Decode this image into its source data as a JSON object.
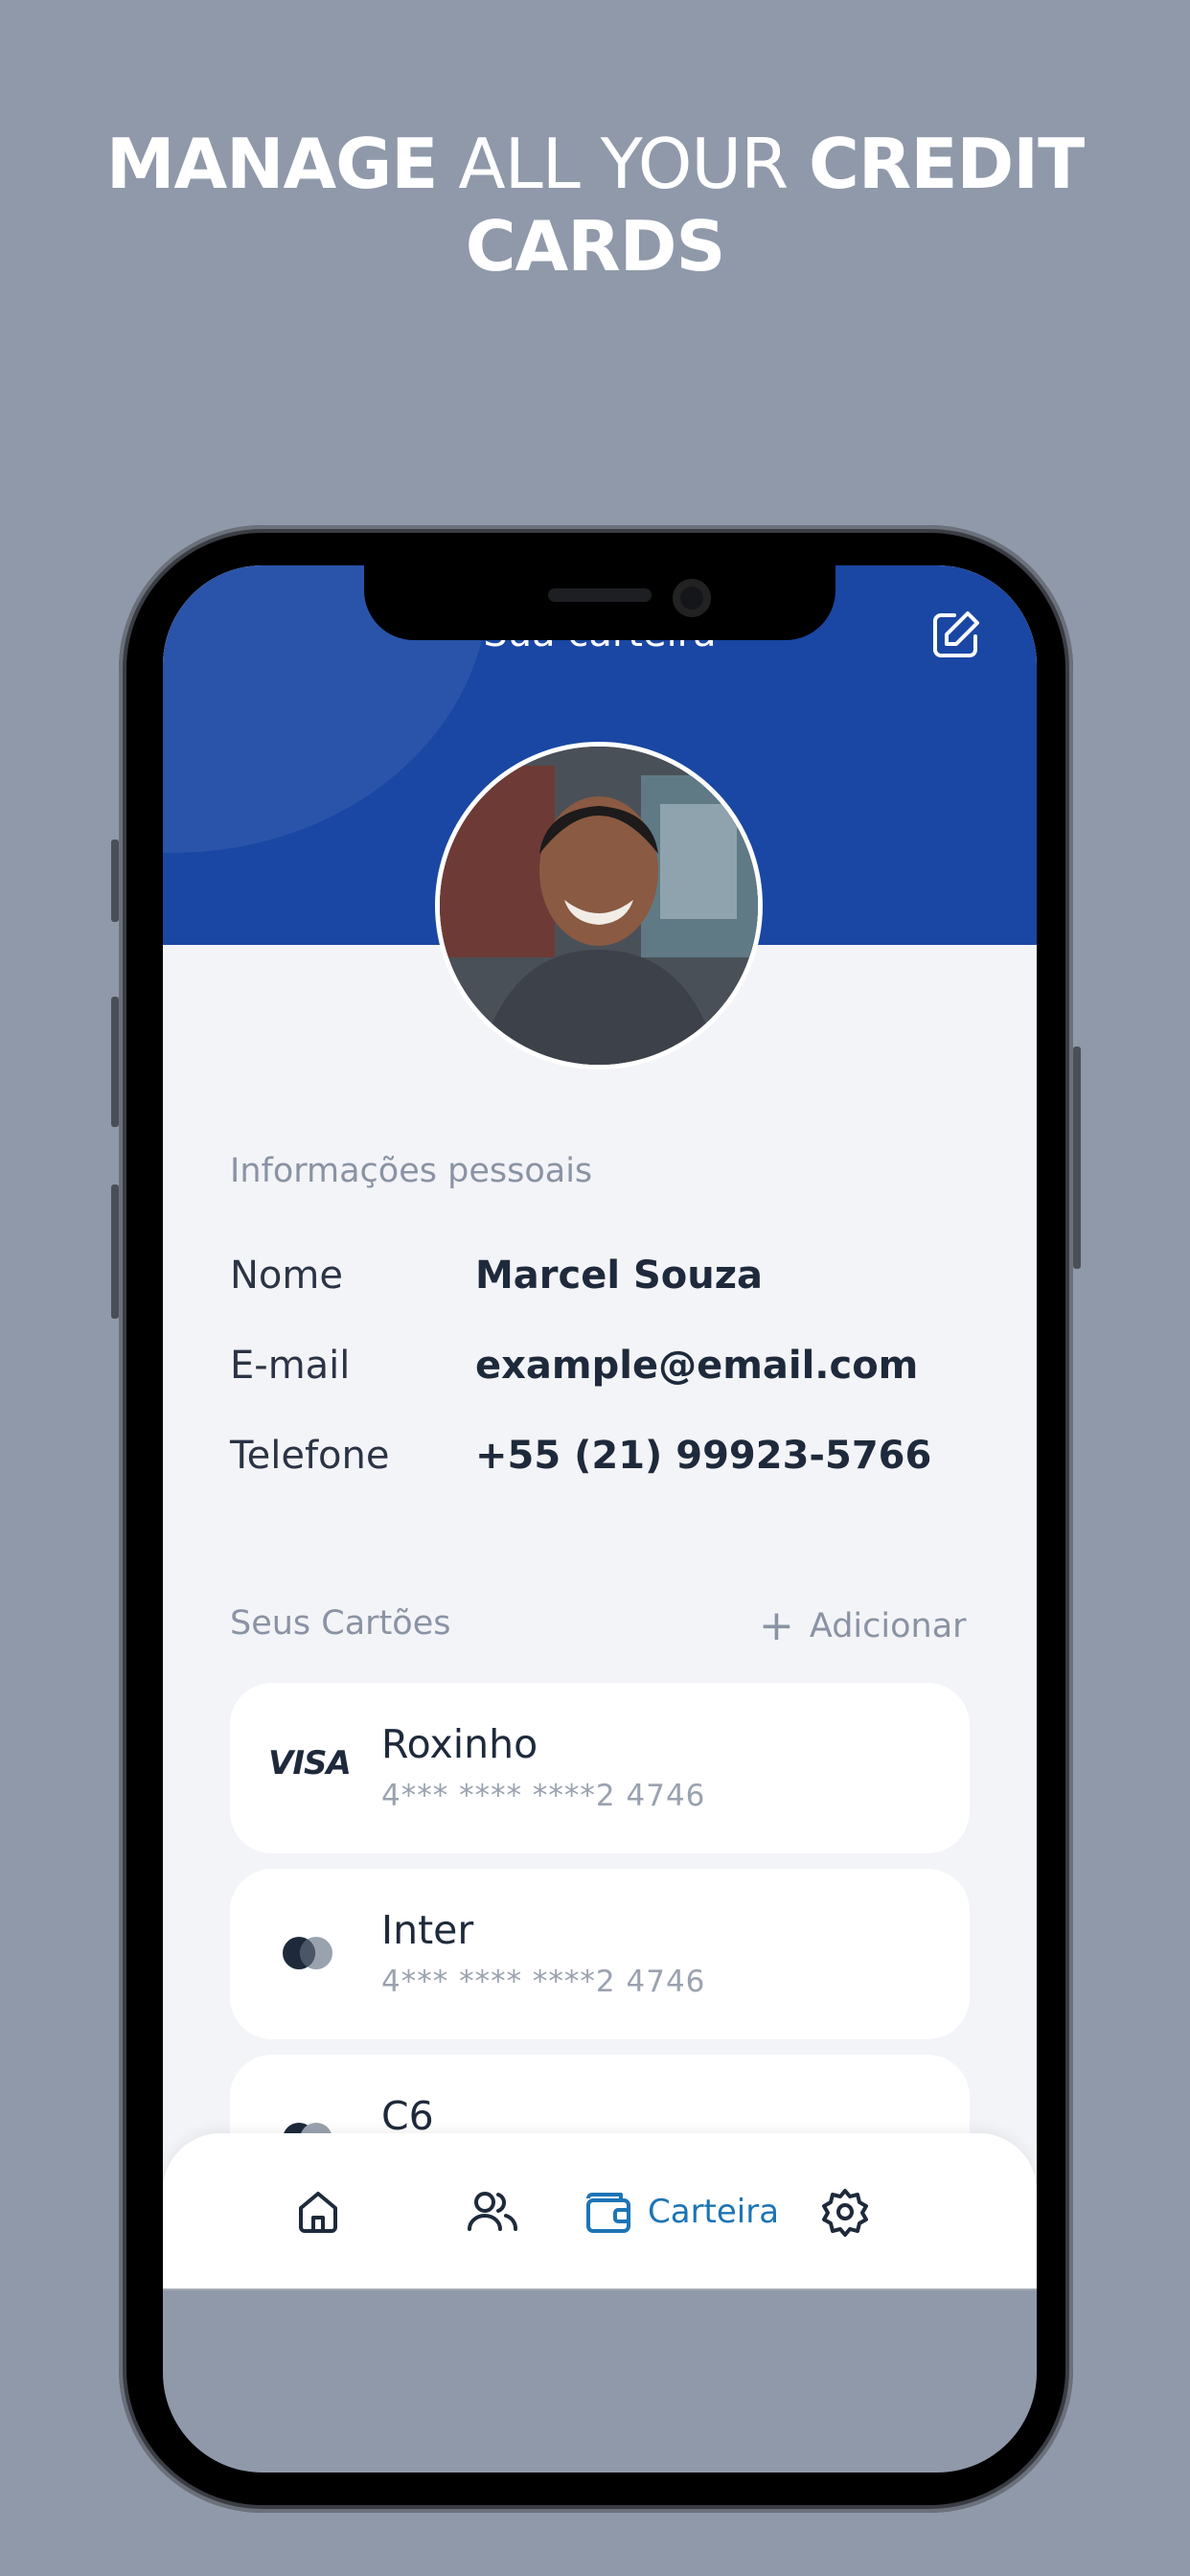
{
  "headline": {
    "bold_1": "MANAGE",
    "light": "ALL YOUR",
    "bold_2": "CREDIT",
    "line2": "CARDS"
  },
  "header": {
    "title": "Sua carteira",
    "edit_icon": "edit-icon"
  },
  "profile": {
    "section_label": "Informações pessoais",
    "fields": [
      {
        "label": "Nome",
        "value": "Marcel Souza"
      },
      {
        "label": "E-mail",
        "value": "example@email.com"
      },
      {
        "label": "Telefone",
        "value": "+55 (21) 99923-5766"
      }
    ]
  },
  "cards_section": {
    "label": "Seus Cartões",
    "add_label": "Adicionar",
    "cards": [
      {
        "name": "Roxinho",
        "number": "4*** **** ****2 4746",
        "brand": "VISA"
      },
      {
        "name": "Inter",
        "number": "4*** **** ****2 4746",
        "brand": "mastercard-icon"
      },
      {
        "name": "C6",
        "brand": "mastercard-icon"
      }
    ]
  },
  "tabbar": {
    "active_label": "Carteira",
    "items": [
      "home-icon",
      "users-icon",
      "wallet-icon",
      "settings-icon"
    ],
    "active_color": "#1d74b5"
  },
  "colors": {
    "background": "#8f99aa",
    "header": "#1a47a3",
    "text_dark": "#1e2a3b",
    "text_muted": "#8a93a3"
  }
}
